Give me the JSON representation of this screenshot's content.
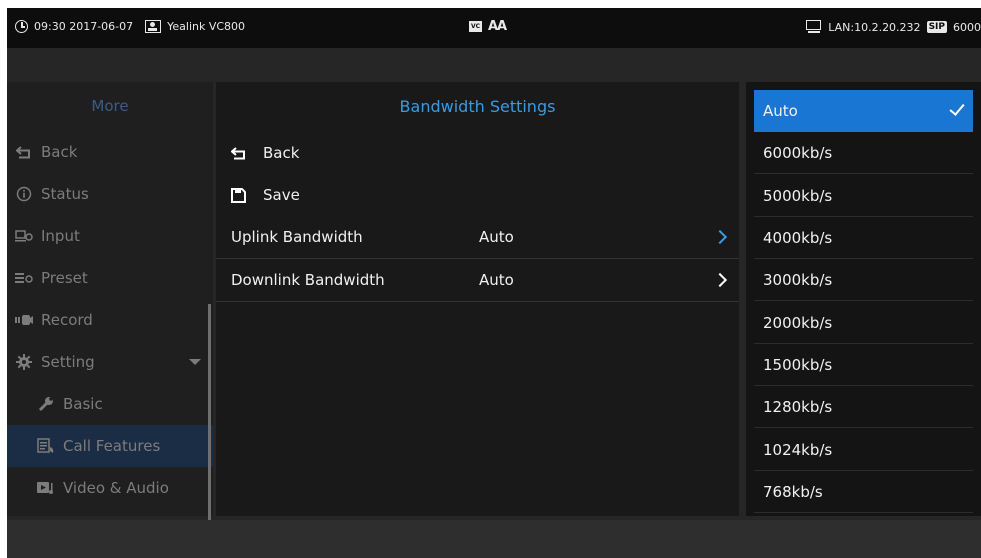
{
  "status_bar": {
    "time_date": "09:30 2017-06-07",
    "device_name": "Yealink VC800",
    "lan": "LAN:10.2.20.232",
    "sip_badge": "SIP",
    "sip_account": "6000",
    "icons": [
      "clock-icon",
      "person-icon",
      "vc-icon",
      "font-size-icon",
      "monitor-icon"
    ]
  },
  "sidebar": {
    "title": "More",
    "items": [
      {
        "label": "Back",
        "icon": "back-icon"
      },
      {
        "label": "Status",
        "icon": "info-icon"
      },
      {
        "label": "Input",
        "icon": "input-icon"
      },
      {
        "label": "Preset",
        "icon": "preset-icon"
      },
      {
        "label": "Record",
        "icon": "record-icon"
      },
      {
        "label": "Setting",
        "icon": "gear-icon"
      },
      {
        "label": "Basic",
        "icon": "wrench-icon"
      },
      {
        "label": "Call Features",
        "icon": "call-features-icon"
      },
      {
        "label": "Video & Audio",
        "icon": "video-audio-icon"
      }
    ]
  },
  "main": {
    "title": "Bandwidth Settings",
    "back_label": "Back",
    "save_label": "Save",
    "uplink_label": "Uplink Bandwidth",
    "uplink_value": "Auto",
    "downlink_label": "Downlink Bandwidth",
    "downlink_value": "Auto"
  },
  "options": {
    "selected": "Auto",
    "items": [
      "Auto",
      "6000kb/s",
      "5000kb/s",
      "4000kb/s",
      "3000kb/s",
      "2000kb/s",
      "1500kb/s",
      "1280kb/s",
      "1024kb/s",
      "768kb/s"
    ]
  },
  "colors": {
    "accent": "#1976d2",
    "title_blue": "#3a9be0",
    "sidebar_title": "#3d5b84",
    "selected_sidebar": "#1b2c45"
  }
}
